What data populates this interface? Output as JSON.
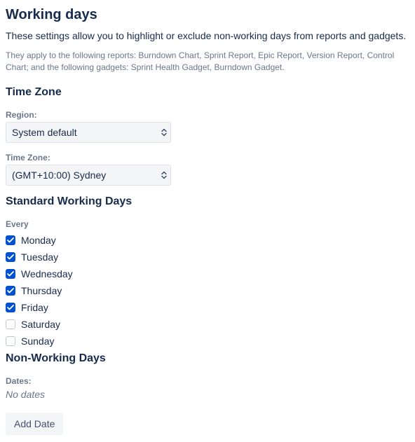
{
  "header": {
    "title": "Working days",
    "intro": "These settings allow you to highlight or exclude non-working days from reports and gadgets.",
    "subnote": "They apply to the following reports: Burndown Chart, Sprint Report, Epic Report, Version Report, Control Chart; and the following gadgets: Sprint Health Gadget, Burndown Gadget."
  },
  "timezone": {
    "section_title": "Time Zone",
    "region_label": "Region:",
    "region_value": "System default",
    "tz_label": "Time Zone:",
    "tz_value": "(GMT+10:00) Sydney"
  },
  "working_days": {
    "section_title": "Standard Working Days",
    "every_label": "Every",
    "days": [
      {
        "label": "Monday",
        "checked": true
      },
      {
        "label": "Tuesday",
        "checked": true
      },
      {
        "label": "Wednesday",
        "checked": true
      },
      {
        "label": "Thursday",
        "checked": true
      },
      {
        "label": "Friday",
        "checked": true
      },
      {
        "label": "Saturday",
        "checked": false
      },
      {
        "label": "Sunday",
        "checked": false
      }
    ]
  },
  "non_working": {
    "section_title": "Non-Working Days",
    "dates_label": "Dates:",
    "no_dates": "No dates",
    "add_date_label": "Add Date"
  }
}
